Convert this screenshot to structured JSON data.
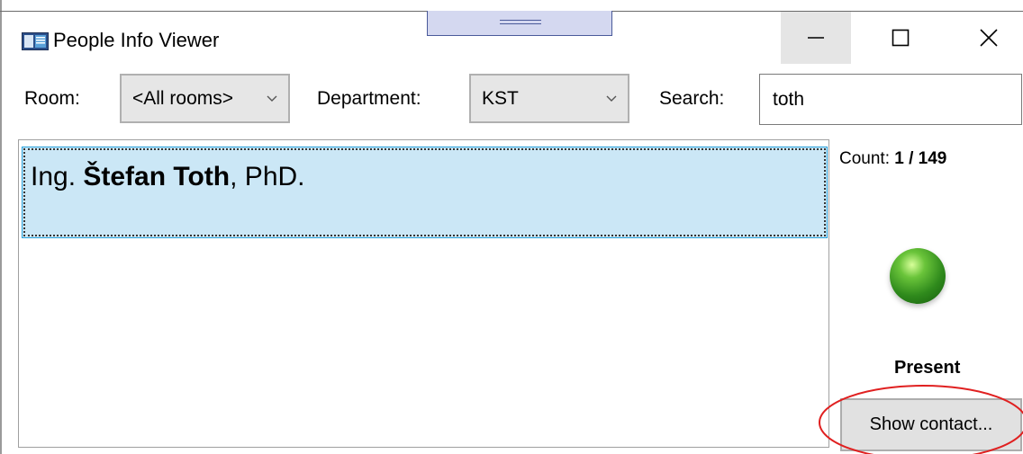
{
  "window": {
    "title": "People Info Viewer",
    "icon": "app-window-icon",
    "controls": {
      "minimize": "minimize-icon",
      "maximize": "maximize-icon",
      "close": "close-icon"
    }
  },
  "filters": {
    "room_label": "Room:",
    "room_value": "<All rooms>",
    "department_label": "Department:",
    "department_value": "KST",
    "search_label": "Search:",
    "search_value": "toth"
  },
  "list": {
    "items": [
      {
        "prefix": "Ing. ",
        "name": "Štefan Toth",
        "suffix": ", PhD."
      }
    ]
  },
  "count": {
    "label": "Count: ",
    "value": "1 / 149"
  },
  "status": {
    "text": "Present",
    "color": "#3a9a22"
  },
  "actions": {
    "show_contact": "Show contact..."
  },
  "colors": {
    "selection": "#cbe7f6",
    "selection_border": "#26a0da",
    "annotation": "#e02020"
  }
}
